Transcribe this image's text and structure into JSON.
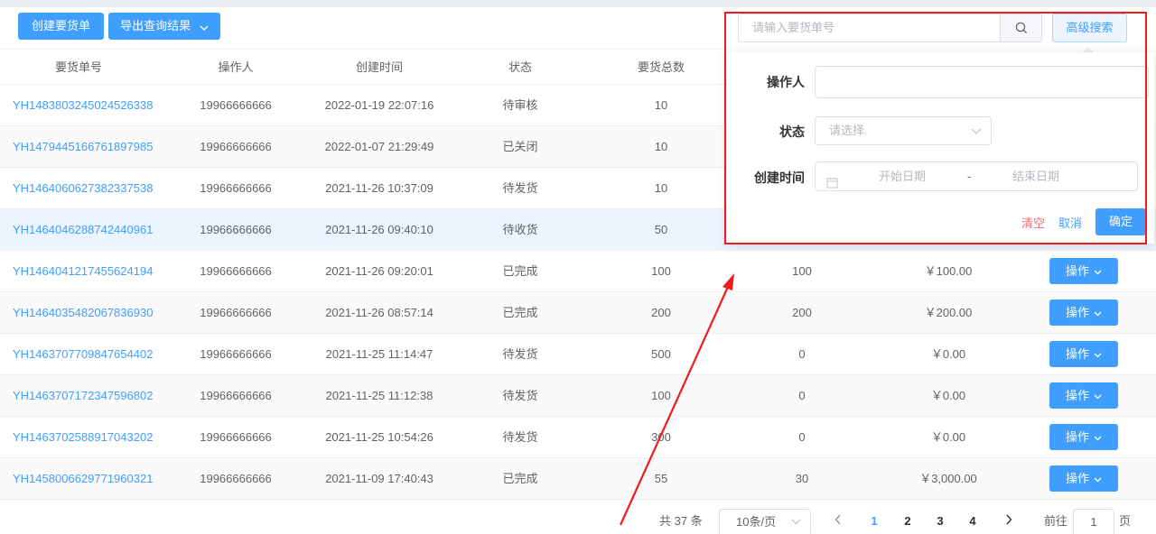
{
  "toolbar": {
    "create_label": "创建要货单",
    "export_label": "导出查询结果"
  },
  "table": {
    "headers": {
      "order_no": "要货单号",
      "operator": "操作人",
      "created": "创建时间",
      "status": "状态",
      "total": "要货总数"
    },
    "rows": [
      {
        "no": "YH1483803245024526338",
        "operator": "19966666666",
        "created": "2022-01-19 22:07:16",
        "status": "待审核",
        "total": "10",
        "sent": "",
        "amount": ""
      },
      {
        "no": "YH1479445166761897985",
        "operator": "19966666666",
        "created": "2022-01-07 21:29:49",
        "status": "已关闭",
        "total": "10",
        "sent": "",
        "amount": ""
      },
      {
        "no": "YH1464060627382337538",
        "operator": "19966666666",
        "created": "2021-11-26 10:37:09",
        "status": "待发货",
        "total": "10",
        "sent": "",
        "amount": ""
      },
      {
        "no": "YH1464046288742440961",
        "operator": "19966666666",
        "created": "2021-11-26 09:40:10",
        "status": "待收货",
        "total": "50",
        "sent": "",
        "amount": ""
      },
      {
        "no": "YH1464041217455624194",
        "operator": "19966666666",
        "created": "2021-11-26 09:20:01",
        "status": "已完成",
        "total": "100",
        "sent": "100",
        "amount": "￥100.00"
      },
      {
        "no": "YH1464035482067836930",
        "operator": "19966666666",
        "created": "2021-11-26 08:57:14",
        "status": "已完成",
        "total": "200",
        "sent": "200",
        "amount": "￥200.00"
      },
      {
        "no": "YH1463707709847654402",
        "operator": "19966666666",
        "created": "2021-11-25 11:14:47",
        "status": "待发货",
        "total": "500",
        "sent": "0",
        "amount": "￥0.00"
      },
      {
        "no": "YH1463707172347596802",
        "operator": "19966666666",
        "created": "2021-11-25 11:12:38",
        "status": "待发货",
        "total": "100",
        "sent": "0",
        "amount": "￥0.00"
      },
      {
        "no": "YH1463702588917043202",
        "operator": "19966666666",
        "created": "2021-11-25 10:54:26",
        "status": "待发货",
        "total": "300",
        "sent": "0",
        "amount": "￥0.00"
      },
      {
        "no": "YH1458006629771960321",
        "operator": "19966666666",
        "created": "2021-11-09 17:40:43",
        "status": "已完成",
        "total": "55",
        "sent": "30",
        "amount": "￥3,000.00"
      }
    ],
    "action_label": "操作"
  },
  "pagination": {
    "total_text": "共 37 条",
    "page_size": "10条/页",
    "pages": [
      "1",
      "2",
      "3",
      "4"
    ],
    "current_page": "1",
    "goto_label": "前往",
    "goto_value": "1",
    "unit_label": "页"
  },
  "search": {
    "placeholder": "请输入要货单号",
    "advanced_label": "高级搜索",
    "operator_label": "操作人",
    "status_label": "状态",
    "status_placeholder": "请选择",
    "created_label": "创建时间",
    "start_placeholder": "开始日期",
    "range_separator": "-",
    "end_placeholder": "结束日期",
    "clear_label": "清空",
    "cancel_label": "取消",
    "confirm_label": "确定"
  },
  "colors": {
    "primary": "#409eff",
    "danger": "#f56c6c",
    "annotation": "#f01c1c"
  }
}
